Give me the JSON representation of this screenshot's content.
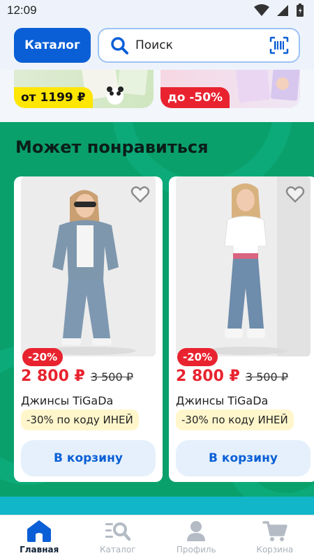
{
  "status_bar": {
    "time": "12:09"
  },
  "header": {
    "catalog_label": "Каталог",
    "search_placeholder": "Поиск"
  },
  "banners": [
    {
      "tag": "от 1199 ₽"
    },
    {
      "tag": "до -50%"
    }
  ],
  "section": {
    "title": "Может понравиться",
    "products": [
      {
        "discount": "-20%",
        "price": "2 800 ₽",
        "old_price": "3 500 ₽",
        "title": "Джинсы TiGaDa",
        "promo": "-30% по коду ИНЕЙ",
        "cart_label": "В корзину"
      },
      {
        "discount": "-20%",
        "price": "2 800 ₽",
        "old_price": "3 500 ₽",
        "title": "Джинсы TiGaDa",
        "promo": "-30% по коду ИНЕЙ",
        "cart_label": "В корзину"
      }
    ]
  },
  "bottom_nav": {
    "items": [
      {
        "label": "Главная",
        "icon": "home-icon",
        "active": true
      },
      {
        "label": "Каталог",
        "icon": "catalog-search-icon",
        "active": false
      },
      {
        "label": "Профиль",
        "icon": "profile-icon",
        "active": false
      },
      {
        "label": "Корзина",
        "icon": "cart-icon",
        "active": false
      }
    ]
  },
  "colors": {
    "brand_blue": "#0a5fd6",
    "promo_green": "#0aa06b",
    "price_red": "#e8232f",
    "promo_yellow": "#fff6cc"
  }
}
